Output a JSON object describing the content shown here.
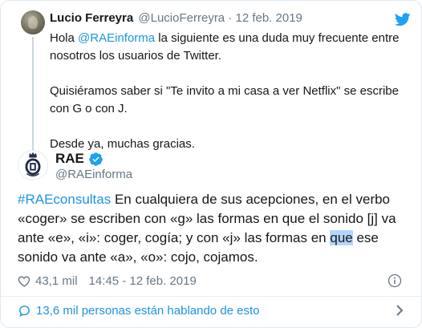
{
  "parent_tweet": {
    "author_name": "Lucio Ferreyra",
    "meta": "@LucioFerreyra · 12 feb. 2019",
    "greeting": "Hola",
    "mention": "@RAEinforma",
    "line1_rest": " la siguiente es una duda muy frecuente entre nosotros los usuarios de Twitter.",
    "paragraph2": "Quisiéramos saber si \"Te invito a mi casa a ver Netflix\" se escribe con G o con J.",
    "paragraph3": "Desde ya, muchas gracias."
  },
  "main_tweet": {
    "author_name": "RAE",
    "handle": "@RAEinforma",
    "hashtag": "#RAEconsultas",
    "text_before_highlight": " En cualquiera de sus acepciones, en el verbo «coger» se escriben con «g» las formas en que el sonido [j] va ante «e», «i»: coger, cogía; y con «j» las formas en ",
    "highlighted_word": "que",
    "text_after_highlight": " ese sonido va ante «a», «o»: cojo, cojamos.",
    "like_count": "43,1 mil",
    "timestamp": "14:45 - 12 feb. 2019"
  },
  "conversation": {
    "label": "13,6 mil personas están hablando de esto"
  },
  "colors": {
    "accent": "#1b95e0",
    "secondary_text": "#657786",
    "primary_text": "#14171a",
    "highlight": "#b4d7ff",
    "twitter_blue": "#1da1f2"
  },
  "icons": [
    "twitter-bird-icon",
    "verified-badge-icon",
    "heart-icon",
    "info-icon",
    "speech-bubble-icon",
    "chevron-right-icon"
  ]
}
